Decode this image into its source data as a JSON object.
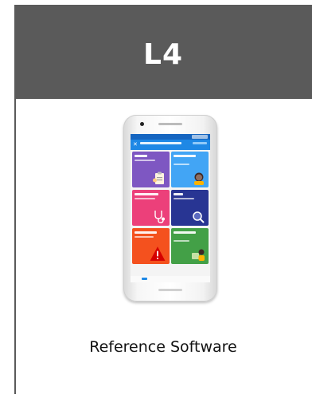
{
  "card": {
    "title": "L4",
    "caption": "Reference Software"
  },
  "phone": {
    "icon": "phone-icon",
    "screen_icon": "app-screen-icon"
  },
  "colors": {
    "header": "#5a5a5a",
    "app_bar": "#1e88e5",
    "tile_profile": "#7e57c2",
    "tile_symptoms": "#42a5f5",
    "tile_physical": "#ec407a",
    "tile_tests": "#283593",
    "tile_danger": "#f4511e",
    "tile_counseling": "#43a047"
  }
}
